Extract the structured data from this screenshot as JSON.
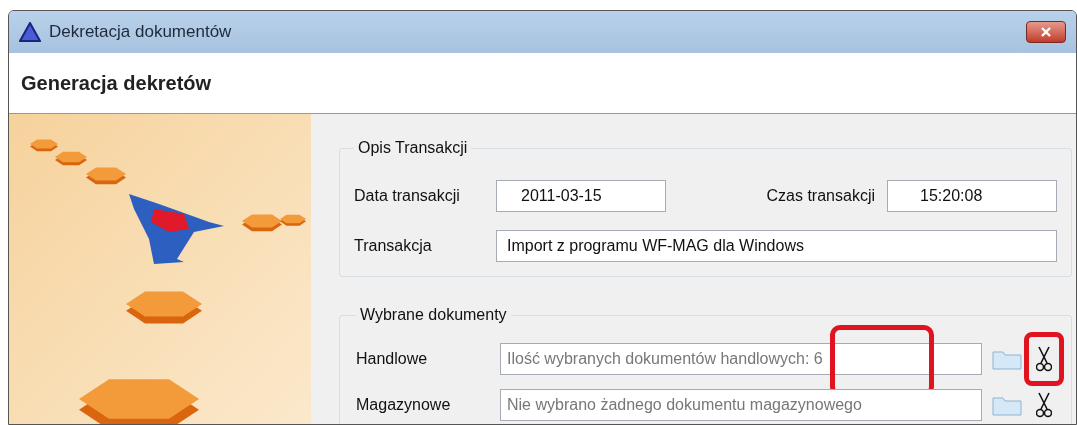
{
  "window": {
    "title": "Dekretacja dokumentów"
  },
  "header": "Generacja dekretów",
  "transaction": {
    "title": "Opis Transakcji",
    "date": {
      "label": "Data transakcji",
      "value": "2011-03-15"
    },
    "time": {
      "label": "Czas transakcji",
      "value": "15:20:08"
    },
    "name": {
      "label": "Transakcja",
      "value": "Import z programu WF-MAG dla Windows"
    }
  },
  "documents": {
    "title": "Wybrane dokumenty",
    "rows": [
      {
        "label": "Handlowe",
        "value": "Ilość wybranych dokumentów handlowych: 6",
        "highlighted": true
      },
      {
        "label": "Magazynowe",
        "value": "Nie wybrano żadnego dokumentu magazynowego",
        "highlighted": false
      }
    ]
  }
}
